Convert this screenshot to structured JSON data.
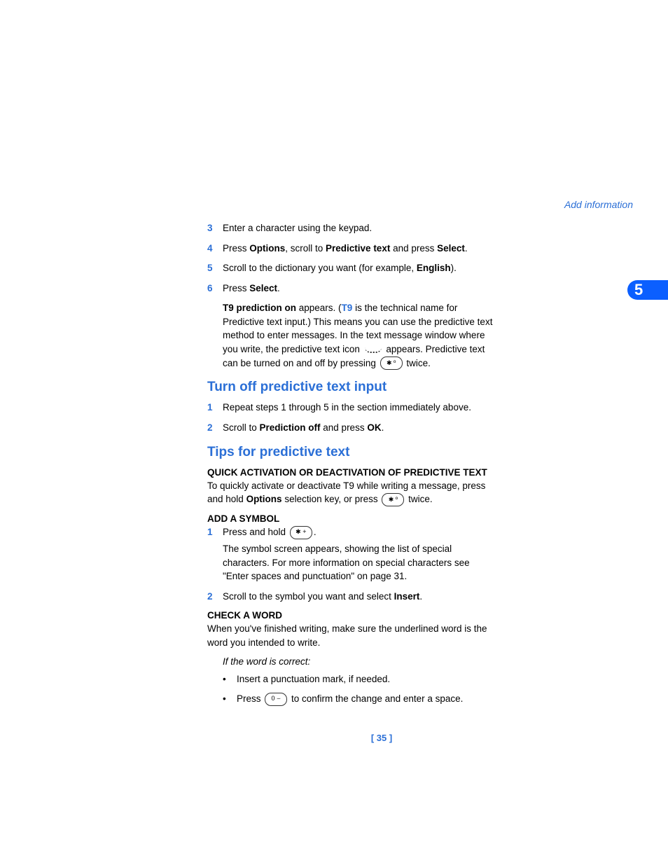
{
  "header": {
    "link": "Add information"
  },
  "chapter": "5",
  "steps_top": [
    {
      "num": "3",
      "parts": [
        {
          "t": "Enter a character using the keypad."
        }
      ]
    },
    {
      "num": "4",
      "parts": [
        {
          "t": "Press "
        },
        {
          "b": "Options"
        },
        {
          "t": ", scroll to "
        },
        {
          "b": "Predictive text"
        },
        {
          "t": " and press "
        },
        {
          "b": "Select"
        },
        {
          "t": "."
        }
      ]
    },
    {
      "num": "5",
      "parts": [
        {
          "t": "Scroll to the dictionary you want (for example, "
        },
        {
          "b": "English"
        },
        {
          "t": ")."
        }
      ]
    },
    {
      "num": "6",
      "parts": [
        {
          "t": "Press "
        },
        {
          "b": "Select"
        },
        {
          "t": "."
        }
      ]
    }
  ],
  "body1": {
    "pre": "T9 prediction on",
    "mid1": " appears. (",
    "t9": "T9",
    "mid2": " is the technical name for Predictive text input.) This means you can use the predictive text method to enter messages. In the text message window where you write, the predictive text icon ",
    "mid3": " appears. Predictive text can be turned on and off by pressing ",
    "key1": "✱ º",
    "tail": " twice."
  },
  "h2a": "Turn off predictive text input",
  "steps_off": [
    {
      "num": "1",
      "parts": [
        {
          "t": "Repeat steps 1 through 5 in the section immediately above."
        }
      ]
    },
    {
      "num": "2",
      "parts": [
        {
          "t": "Scroll to "
        },
        {
          "b": "Prediction off"
        },
        {
          "t": " and press "
        },
        {
          "b": "OK"
        },
        {
          "t": "."
        }
      ]
    }
  ],
  "h2b": "Tips for predictive text",
  "sub1": "QUICK ACTIVATION OR DEACTIVATION OF PREDICTIVE TEXT",
  "quick": {
    "p1": "To quickly activate or deactivate T9 while writing a message, press and hold ",
    "b1": "Options",
    "p2": " selection key, or press ",
    "key": "✱ º",
    "tail": " twice."
  },
  "sub2": "ADD A SYMBOL",
  "add_symbol": [
    {
      "num": "1",
      "line1a": "Press and hold ",
      "key": "✱ +",
      "line1b": ".",
      "line2": "The symbol screen appears, showing the list of special characters. For more information on special characters see \"Enter spaces and punctuation\" on page 31."
    },
    {
      "num": "2",
      "parts": [
        {
          "t": "Scroll to the symbol you want and select "
        },
        {
          "b": "Insert"
        },
        {
          "t": "."
        }
      ]
    }
  ],
  "sub3": "CHECK A WORD",
  "check_para": "When you've finished writing, make sure the underlined word is the word you intended to write.",
  "if_correct": "If the word is correct:",
  "bullets": [
    {
      "t": "Insert a punctuation mark, if needed."
    },
    {
      "pre": "Press ",
      "key": "0 ⌣",
      "post": " to confirm the change and enter a space."
    }
  ],
  "footer": "[ 35 ]"
}
